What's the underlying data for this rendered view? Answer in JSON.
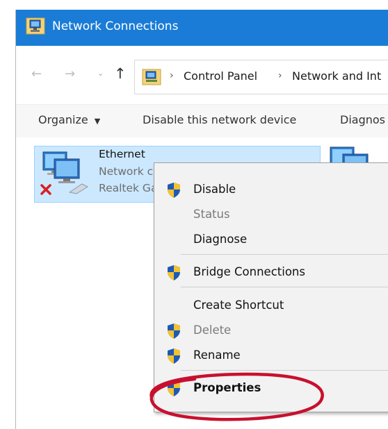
{
  "window": {
    "title": "Network Connections",
    "title_bar_color": "#1a7cd6"
  },
  "address_bar": {
    "breadcrumbs": [
      "Control Panel",
      "Network and Int"
    ],
    "back_icon": "arrow-left-icon",
    "forward_icon": "arrow-right-icon",
    "recent_icon": "chevron-down-icon",
    "up_icon": "arrow-up-icon"
  },
  "command_bar": {
    "organize": "Organize",
    "disable_device": "Disable this network device",
    "diagnose": "Diagnos"
  },
  "connections": [
    {
      "name": "Ethernet",
      "status": "Network cable unplugged",
      "device": "Realtek Gan",
      "selected": true
    }
  ],
  "context_menu": {
    "items": [
      {
        "label": "Disable",
        "shield": true,
        "enabled": true,
        "bold": false
      },
      {
        "label": "Status",
        "shield": false,
        "enabled": false,
        "bold": false
      },
      {
        "label": "Diagnose",
        "shield": false,
        "enabled": true,
        "bold": false
      },
      {
        "label": "Bridge Connections",
        "shield": true,
        "enabled": true,
        "bold": false
      },
      {
        "label": "Create Shortcut",
        "shield": false,
        "enabled": true,
        "bold": false
      },
      {
        "label": "Delete",
        "shield": true,
        "enabled": false,
        "bold": false
      },
      {
        "label": "Rename",
        "shield": true,
        "enabled": true,
        "bold": false
      },
      {
        "label": "Properties",
        "shield": true,
        "enabled": true,
        "bold": true
      }
    ]
  },
  "annotation": {
    "highlight_color": "#c8102e"
  }
}
